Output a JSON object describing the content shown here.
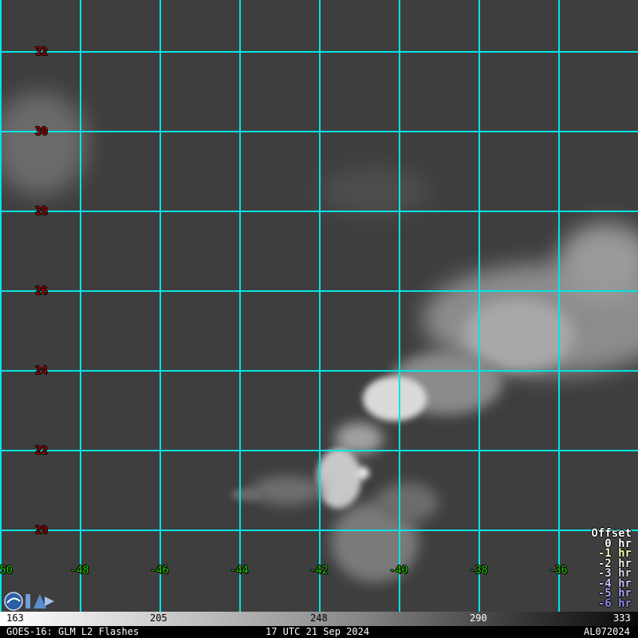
{
  "map": {
    "lat_labels": [
      "32",
      "30",
      "28",
      "26",
      "24",
      "22",
      "20"
    ],
    "lon_labels": [
      "50",
      "-48",
      "-46",
      "-44",
      "-42",
      "-40",
      "-38",
      "-36"
    ],
    "grid_color": "#00e5e5"
  },
  "offset_legend": {
    "title": "Offset",
    "items": [
      {
        "label": "0 hr",
        "color": "#ffffff"
      },
      {
        "label": "-1 hr",
        "color": "#ffffc0"
      },
      {
        "label": "-2 hr",
        "color": "#f0f0e0"
      },
      {
        "label": "-3 hr",
        "color": "#dcdcec"
      },
      {
        "label": "-4 hr",
        "color": "#c4c4f0"
      },
      {
        "label": "-5 hr",
        "color": "#a8a8f0"
      },
      {
        "label": "-6 hr",
        "color": "#8c8ce8"
      }
    ]
  },
  "colorbar": {
    "ticks": [
      "163",
      "205",
      "248",
      "290",
      "333"
    ]
  },
  "footer": {
    "left": "GOES-16: GLM L2 Flashes",
    "center": "17 UTC 21 Sep 2024",
    "right": "AL072024"
  }
}
